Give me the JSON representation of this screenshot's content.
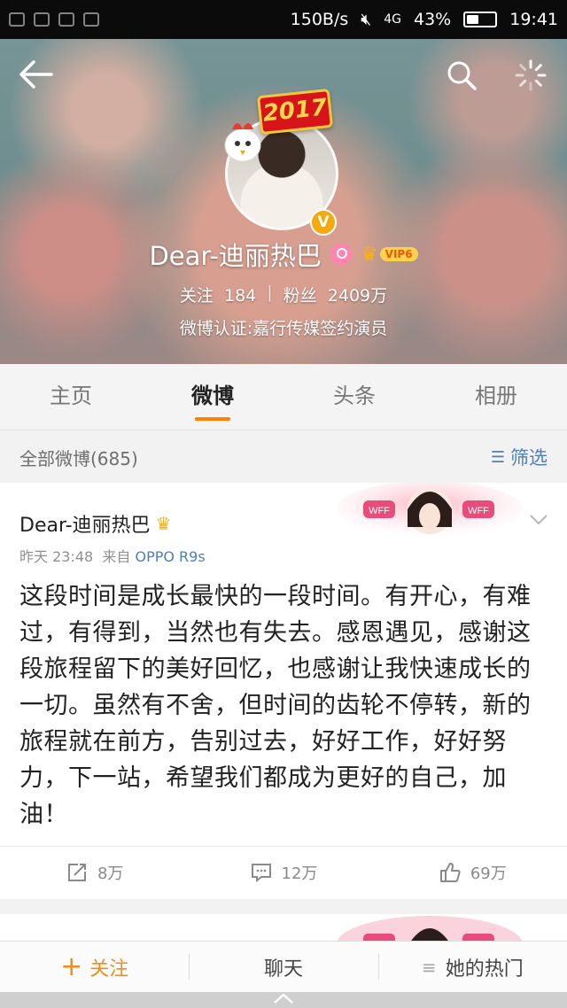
{
  "status_bar": {
    "speed": "150B/s",
    "signal": "4G",
    "battery": "43%",
    "battery_level": 0.43,
    "time": "19:41"
  },
  "profile": {
    "name": "Dear-迪丽热巴",
    "year_badge": "2017",
    "verified_badge": "V",
    "vip_label": "VIP6",
    "following_label": "关注",
    "following_count": "184",
    "divider": "|",
    "followers_label": "粉丝",
    "followers_count": "2409万",
    "verification": "微博认证:嘉行传媒签约演员"
  },
  "tabs": [
    {
      "label": "主页",
      "active": false
    },
    {
      "label": "微博",
      "active": true
    },
    {
      "label": "头条",
      "active": false
    },
    {
      "label": "相册",
      "active": false
    }
  ],
  "filter": {
    "all_label": "全部微博(685)",
    "filter_label": "筛选"
  },
  "post": {
    "author": "Dear-迪丽热巴",
    "time": "昨天 23:48",
    "source_prefix": "来自",
    "device": "OPPO R9s",
    "text": "这段时间是成长最快的一段时间。有开心，有难过，有得到，当然也有失去。感恩遇见，感谢这段旅程留下的美好回忆，也感谢让我快速成长的一切。虽然有不舍，但时间的齿轮不停转，新的旅程就在前方，告别过去，好好工作，好好努力，下一站，希望我们都成为更好的自己，加油！",
    "deco_text": "WFF",
    "repost_count": "8万",
    "comment_count": "12万",
    "like_count": "69万"
  },
  "bottom_bar": {
    "follow": "关注",
    "chat": "聊天",
    "hot": "她的热门"
  },
  "colors": {
    "accent": "#ff8200",
    "link": "#4f7fb7",
    "vip": "#ffd24d"
  }
}
